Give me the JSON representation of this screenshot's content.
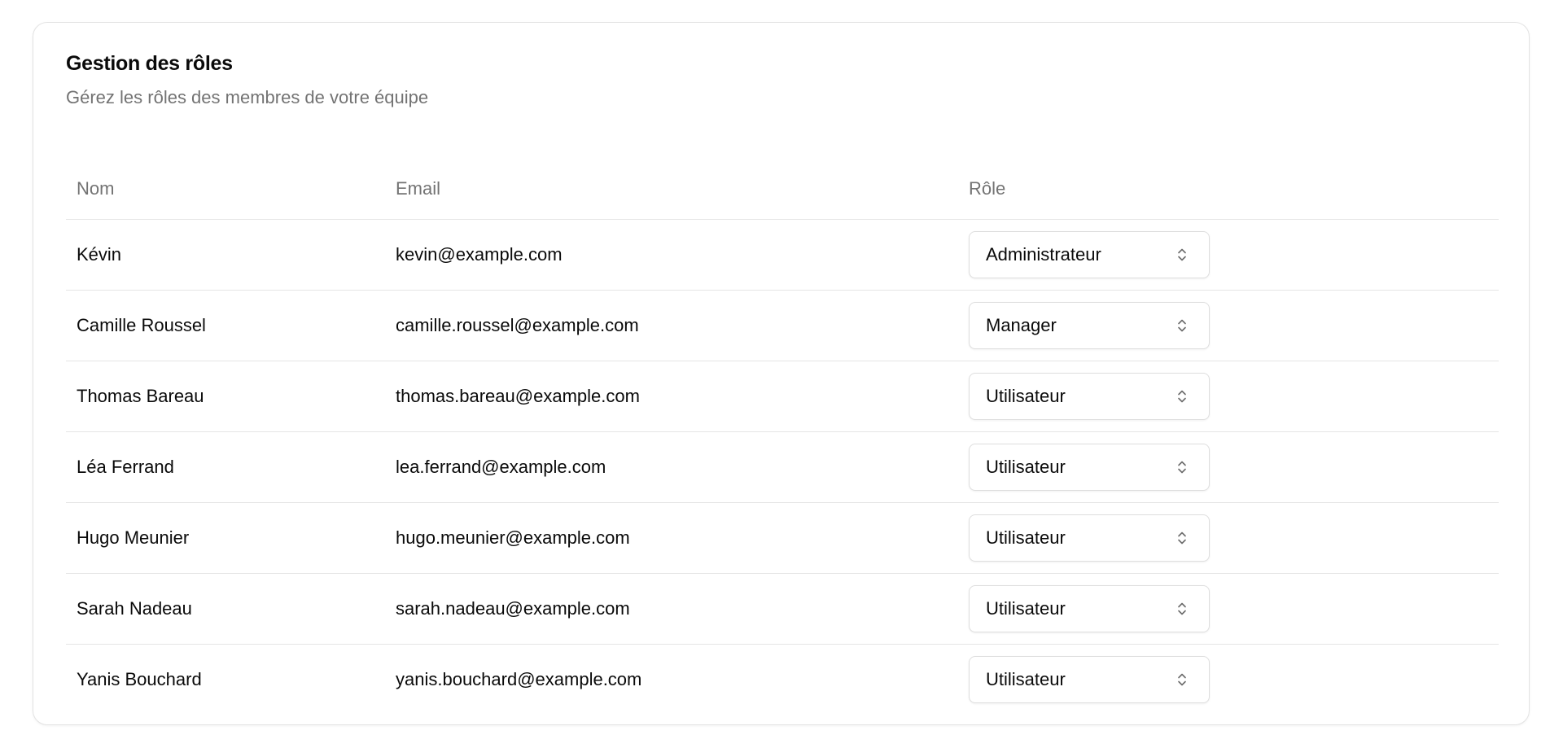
{
  "card": {
    "title": "Gestion des rôles",
    "subtitle": "Gérez les rôles des membres de votre équipe"
  },
  "table": {
    "headers": [
      "Nom",
      "Email",
      "Rôle"
    ],
    "rows": [
      {
        "name": "Kévin",
        "email": "kevin@example.com",
        "role": "Administrateur"
      },
      {
        "name": "Camille Roussel",
        "email": "camille.roussel@example.com",
        "role": "Manager"
      },
      {
        "name": "Thomas Bareau",
        "email": "thomas.bareau@example.com",
        "role": "Utilisateur"
      },
      {
        "name": "Léa Ferrand",
        "email": "lea.ferrand@example.com",
        "role": "Utilisateur"
      },
      {
        "name": "Hugo Meunier",
        "email": "hugo.meunier@example.com",
        "role": "Utilisateur"
      },
      {
        "name": "Sarah Nadeau",
        "email": "sarah.nadeau@example.com",
        "role": "Utilisateur"
      },
      {
        "name": "Yanis Bouchard",
        "email": "yanis.bouchard@example.com",
        "role": "Utilisateur"
      }
    ]
  },
  "icons": {
    "select_chevron": "chevron-up-down-icon"
  },
  "colors": {
    "muted_text": "#737373",
    "border": "#e5e5e5"
  }
}
